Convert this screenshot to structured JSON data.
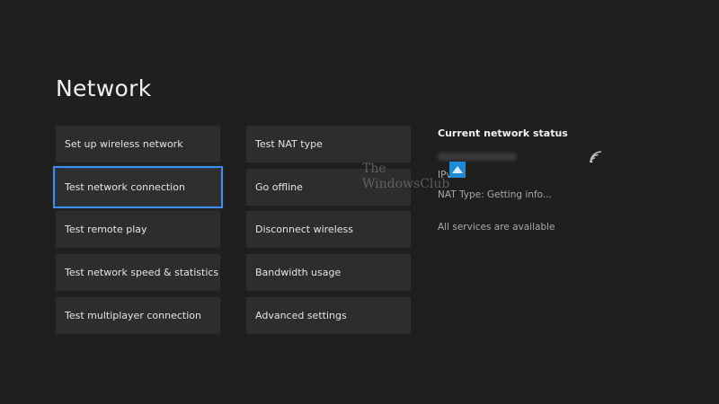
{
  "header": {
    "title": "Network"
  },
  "left_column": {
    "items": [
      {
        "label": "Set up wireless network"
      },
      {
        "label": "Test network connection"
      },
      {
        "label": "Test remote play"
      },
      {
        "label": "Test network speed & statistics"
      },
      {
        "label": "Test multiplayer connection"
      }
    ]
  },
  "middle_column": {
    "items": [
      {
        "label": "Test NAT type"
      },
      {
        "label": "Go offline"
      },
      {
        "label": "Disconnect wireless"
      },
      {
        "label": "Bandwidth usage"
      },
      {
        "label": "Advanced settings"
      }
    ]
  },
  "status": {
    "heading": "Current network status",
    "ip_label": "IPv4",
    "nat_label": "NAT Type: Getting info...",
    "services_label": "All services are available"
  },
  "watermark": {
    "line1": "The",
    "line2": "WindowsClub"
  },
  "colors": {
    "background": "#1f1f1f",
    "tile": "#2d2d2d",
    "focus_accent": "#3f8ff0"
  },
  "icons": {
    "wifi": "wifi-signal-icon",
    "watermark_logo": "windowsclub-logo"
  }
}
